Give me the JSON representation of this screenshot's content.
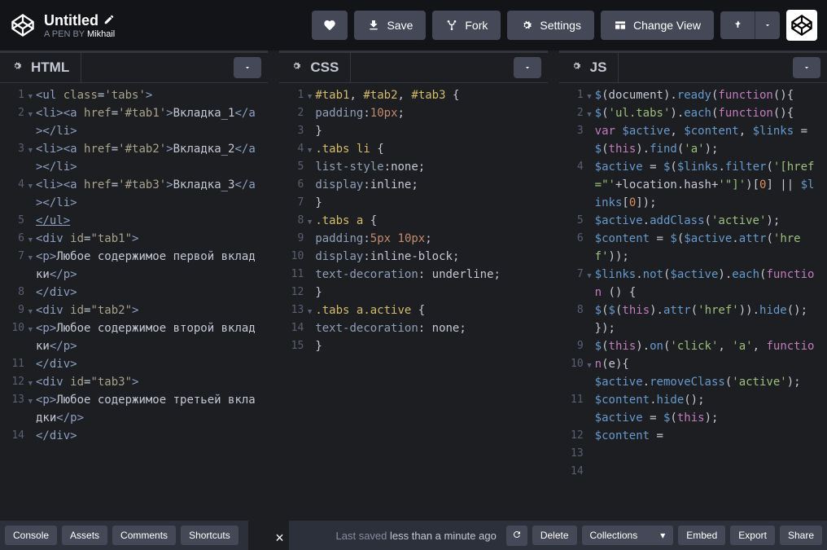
{
  "header": {
    "title": "Untitled",
    "subtitle_prefix": "A PEN BY ",
    "author": "Mikhail",
    "buttons": {
      "save": "Save",
      "fork": "Fork",
      "settings": "Settings",
      "change_view": "Change View"
    }
  },
  "panels": {
    "html": {
      "title": "HTML"
    },
    "css": {
      "title": "CSS"
    },
    "js": {
      "title": "JS"
    }
  },
  "code_html": {
    "lines": [
      "<ul class='tabs'>",
      "<li><a href='#tab1'>Вкладка_1</a></li>",
      "<li><a href='#tab2'>Вкладка_2</a></li>",
      "<li><a href='#tab3'>Вкладка_3</a></li>",
      "</ul>",
      "<div id=\"tab1\">",
      "<p>Любое содержимое первой вкладки</p>",
      "</div>",
      "<div id=\"tab2\">",
      "<p>Любое содержимое второй вкладки</p>",
      "</div>",
      "<div id=\"tab3\">",
      "<p>Любое содержимое третьей вкладки</p>",
      "</div>"
    ]
  },
  "code_css": {
    "lines": [
      "#tab1, #tab2, #tab3 {",
      "padding:10px;",
      "}",
      ".tabs li {",
      "list-style:none;",
      "display:inline;",
      "}",
      ".tabs a {",
      "padding:5px 10px;",
      "display:inline-block;",
      "text-decoration: underline;",
      "}",
      ".tabs a.active {",
      "text-decoration: none;",
      "}"
    ]
  },
  "code_js": {
    "lines": [
      "$(document).ready(function(){",
      "$('ul.tabs').each(function(){",
      "var $active, $content, $links = $(this).find('a');",
      "$active = $($links.filter('[href=\"'+location.hash+'\"]')[0] || $links[0]);",
      "$active.addClass('active');",
      "$content = $($active.attr('href'));",
      "$links.not($active).each(function () {",
      "$($(this).attr('href')).hide();",
      "});",
      "$(this).on('click', 'a', function(e){",
      "$active.removeClass('active');",
      "$content.hide();",
      "$active = $(this);",
      "$content ="
    ]
  },
  "footer": {
    "console": "Console",
    "assets": "Assets",
    "comments": "Comments",
    "shortcuts": "Shortcuts",
    "close_x": "×",
    "last_saved_prefix": "Last saved ",
    "last_saved_time": "less than a minute ago",
    "delete": "Delete",
    "collections": "Collections",
    "embed": "Embed",
    "export": "Export",
    "share": "Share"
  }
}
